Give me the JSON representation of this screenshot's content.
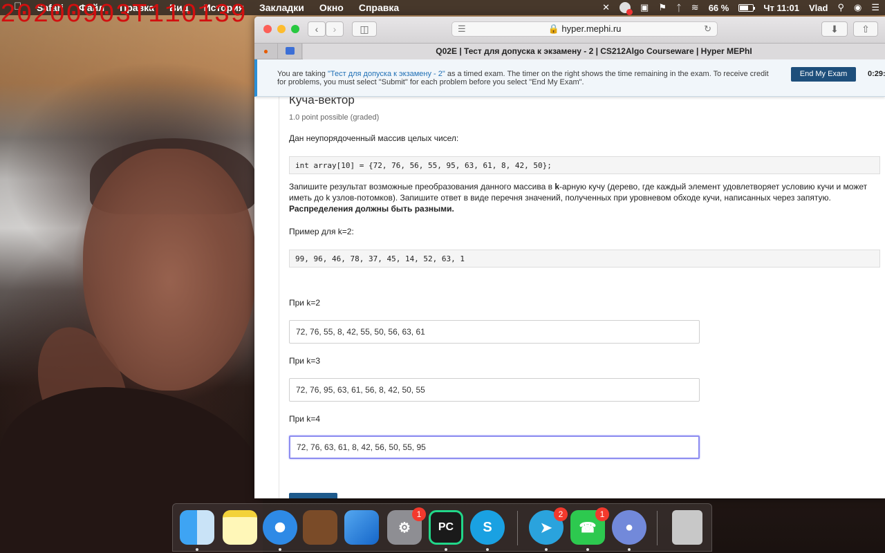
{
  "overlay": {
    "timestamp": "20200903T110139"
  },
  "menubar": {
    "apple_icon": "apple-logo-icon",
    "menus": [
      "Safari",
      "Файл",
      "Правка",
      "Вид",
      "История",
      "Закладки",
      "Окно",
      "Справка"
    ],
    "battery_percent": "66 %",
    "clock": "Чт 11:01",
    "user": "Vlad"
  },
  "browser": {
    "url": "hyper.mephi.ru",
    "tab_title": "Q02E | Тест для допуска к экзамену - 2 | CS212Algo Courseware | Hyper MEPhI"
  },
  "banner": {
    "msg_prefix": "You are taking ",
    "exam_link": "\"Тест для допуска к экзамену - 2\"",
    "msg_suffix": " as a timed exam. The timer on the right shows the time remaining in the exam. To receive credit for problems, you must select \"Submit\" for each problem before you select \"End My Exam\".",
    "end_button": "End My Exam",
    "timer": "0:29:"
  },
  "problem": {
    "title": "Куча-вектор",
    "points": "1.0 point possible (graded)",
    "intro": "Дан неупорядоченный массив целых чисел:",
    "code_array": "int array[10] = {72, 76, 56, 55, 95, 63, 61, 8, 42, 50};",
    "desc_part1": "Запишите результат возможные преобразования данного массива в ",
    "desc_k": "k",
    "desc_part2": "-арную кучу (дерево, где каждый элемент удовлетворяет условию кучи и может иметь до k узлов-потомков). Запишите ответ в виде перечня значений, полученных при уровневом обходе кучи, написанных через запятую. ",
    "desc_bold": "Распределения должны быть разными.",
    "example_label": "Пример для k=2:",
    "example_code": "99, 96, 46, 78, 37, 45, 14, 52, 63, 1",
    "questions": [
      {
        "label": "При k=2",
        "answer": "72, 76, 55, 8, 42, 55, 50, 56, 63, 61"
      },
      {
        "label": "При k=3",
        "answer": "72, 76, 95, 63, 61, 56, 8, 42, 50, 55"
      },
      {
        "label": "При k=4",
        "answer": "72, 76, 63, 61, 8, 42, 56, 50, 55, 95"
      }
    ]
  },
  "dock": {
    "apps": [
      "Finder",
      "Notes",
      "Safari",
      "GarageBand",
      "Xcode",
      "System Preferences",
      "PyCharm",
      "Skype",
      "Telegram",
      "FaceTime",
      "Discord",
      "Trash"
    ],
    "prefs_badge": "1",
    "pycharm_label": "PC",
    "telegram_badge": "2",
    "facetime_badge": "1"
  },
  "colors": {
    "accent": "#1e4f7b",
    "banner_border": "#2a8fd8",
    "focus": "#8c8cf0",
    "timestamp": "#d20f0f"
  }
}
